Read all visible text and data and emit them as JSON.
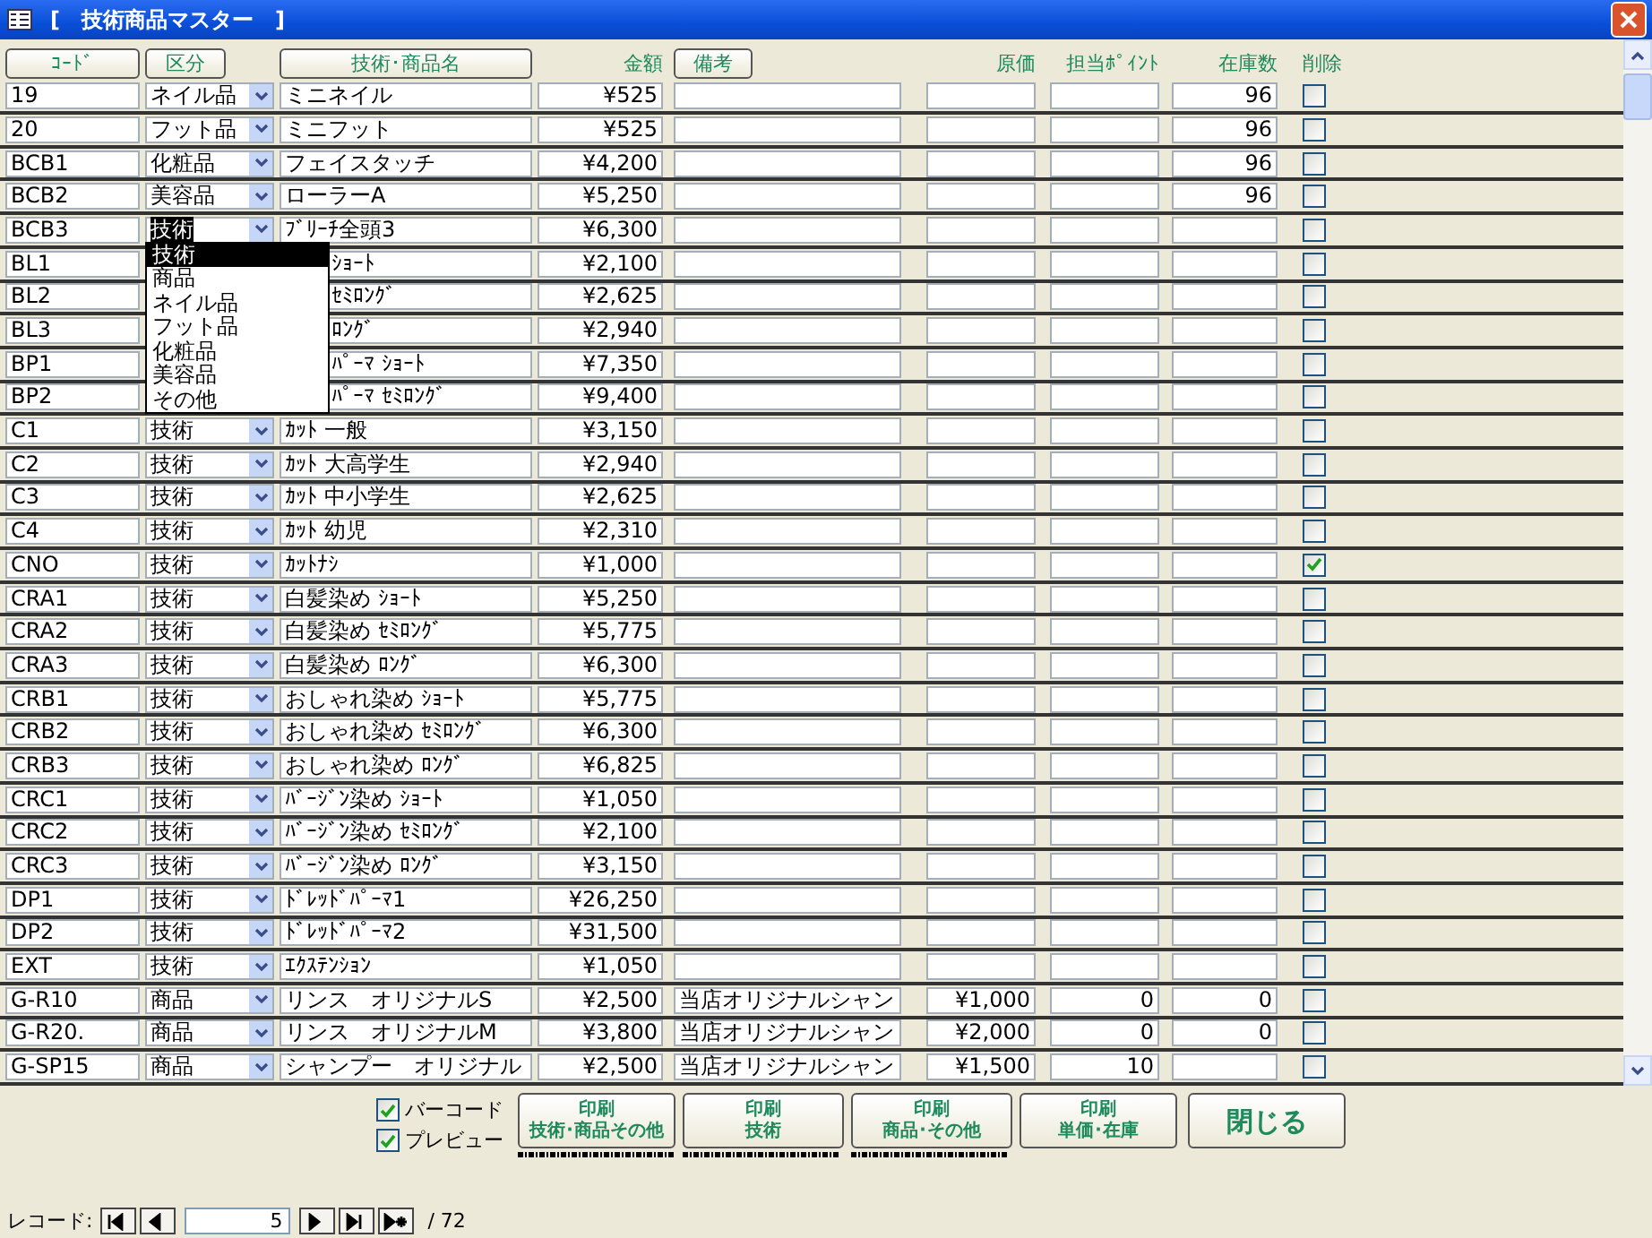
{
  "window": {
    "title": "[　技術商品マスター　]"
  },
  "header": [
    {
      "label": "ｺｰﾄﾞ",
      "kind": "button"
    },
    {
      "label": "区分",
      "kind": "button"
    },
    {
      "label": "技術･商品名",
      "kind": "button"
    },
    {
      "label": "金額",
      "kind": "label"
    },
    {
      "label": "備考",
      "kind": "button"
    },
    {
      "label": "原価",
      "kind": "label"
    },
    {
      "label": "担当ﾎﾟｲﾝﾄ",
      "kind": "label"
    },
    {
      "label": "在庫数",
      "kind": "label"
    },
    {
      "label": "削除",
      "kind": "label"
    }
  ],
  "rows": [
    {
      "code": "19",
      "category": "ネイル品",
      "name": "ミニネイル",
      "price": "¥525",
      "stock": "96",
      "deleted": false,
      "selected": false,
      "covered": false
    },
    {
      "code": "20",
      "category": "フット品",
      "name": "ミニフット",
      "price": "¥525",
      "stock": "96",
      "deleted": false,
      "selected": false,
      "covered": false
    },
    {
      "code": "BCB1",
      "category": "化粧品",
      "name": "フェイスタッチ",
      "price": "¥4,200",
      "stock": "96",
      "deleted": false,
      "selected": false,
      "covered": false
    },
    {
      "code": "BCB2",
      "category": "美容品",
      "name": "ローラーA",
      "price": "¥5,250",
      "stock": "96",
      "deleted": false,
      "selected": false,
      "covered": false
    },
    {
      "code": "BCB3",
      "category": "技術",
      "name": "ﾌﾞﾘｰﾁ全頭3",
      "price": "¥6,300",
      "deleted": false,
      "selected": true,
      "covered": false
    },
    {
      "code": "BL1",
      "name": "ｼｮｰﾄ",
      "price": "¥2,100",
      "deleted": false,
      "covered": true
    },
    {
      "code": "BL2",
      "name": "ｾﾐﾛﾝｸﾞ",
      "price": "¥2,625",
      "deleted": false,
      "covered": true
    },
    {
      "code": "BL3",
      "name": "ﾛﾝｸﾞ",
      "price": "¥2,940",
      "deleted": false,
      "covered": true
    },
    {
      "code": "BP1",
      "name": "ﾊﾟｰﾏ ｼｮｰﾄ",
      "price": "¥7,350",
      "deleted": false,
      "covered": true
    },
    {
      "code": "BP2",
      "name": "ﾊﾟｰﾏ ｾﾐﾛﾝｸﾞ",
      "price": "¥9,400",
      "deleted": false,
      "covered": true
    },
    {
      "code": "C1",
      "category": "技術",
      "name": "ｶｯﾄ 一般",
      "price": "¥3,150",
      "deleted": false,
      "selected": false,
      "covered": false
    },
    {
      "code": "C2",
      "category": "技術",
      "name": "ｶｯﾄ 大高学生",
      "price": "¥2,940",
      "deleted": false,
      "selected": false,
      "covered": false
    },
    {
      "code": "C3",
      "category": "技術",
      "name": "ｶｯﾄ 中小学生",
      "price": "¥2,625",
      "deleted": false,
      "selected": false,
      "covered": false
    },
    {
      "code": "C4",
      "category": "技術",
      "name": "ｶｯﾄ 幼児",
      "price": "¥2,310",
      "deleted": false,
      "selected": false,
      "covered": false
    },
    {
      "code": "CNO",
      "category": "技術",
      "name": "ｶｯﾄﾅｼ",
      "price": "¥1,000",
      "deleted": true,
      "selected": false,
      "covered": false
    },
    {
      "code": "CRA1",
      "category": "技術",
      "name": "白髪染め ｼｮｰﾄ",
      "price": "¥5,250",
      "deleted": false,
      "selected": false,
      "covered": false
    },
    {
      "code": "CRA2",
      "category": "技術",
      "name": "白髪染め ｾﾐﾛﾝｸﾞ",
      "price": "¥5,775",
      "deleted": false,
      "selected": false,
      "covered": false
    },
    {
      "code": "CRA3",
      "category": "技術",
      "name": "白髪染め ﾛﾝｸﾞ",
      "price": "¥6,300",
      "deleted": false,
      "selected": false,
      "covered": false
    },
    {
      "code": "CRB1",
      "category": "技術",
      "name": "おしゃれ染め ｼｮｰﾄ",
      "price": "¥5,775",
      "deleted": false,
      "selected": false,
      "covered": false
    },
    {
      "code": "CRB2",
      "category": "技術",
      "name": "おしゃれ染め ｾﾐﾛﾝｸﾞ",
      "price": "¥6,300",
      "deleted": false,
      "selected": false,
      "covered": false
    },
    {
      "code": "CRB3",
      "category": "技術",
      "name": "おしゃれ染め ﾛﾝｸﾞ",
      "price": "¥6,825",
      "deleted": false,
      "selected": false,
      "covered": false
    },
    {
      "code": "CRC1",
      "category": "技術",
      "name": "ﾊﾞｰｼﾞﾝ染め ｼｮｰﾄ",
      "price": "¥1,050",
      "deleted": false,
      "selected": false,
      "covered": false
    },
    {
      "code": "CRC2",
      "category": "技術",
      "name": "ﾊﾞｰｼﾞﾝ染め ｾﾐﾛﾝｸﾞ",
      "price": "¥2,100",
      "deleted": false,
      "selected": false,
      "covered": false
    },
    {
      "code": "CRC3",
      "category": "技術",
      "name": "ﾊﾞｰｼﾞﾝ染め ﾛﾝｸﾞ",
      "price": "¥3,150",
      "deleted": false,
      "selected": false,
      "covered": false
    },
    {
      "code": "DP1",
      "category": "技術",
      "name": "ﾄﾞﾚｯﾄﾞﾊﾟｰﾏ1",
      "price": "¥26,250",
      "deleted": false,
      "selected": false,
      "covered": false
    },
    {
      "code": "DP2",
      "category": "技術",
      "name": "ﾄﾞﾚｯﾄﾞﾊﾟｰﾏ2",
      "price": "¥31,500",
      "deleted": false,
      "selected": false,
      "covered": false
    },
    {
      "code": "EXT",
      "category": "技術",
      "name": "ｴｸｽﾃﾝｼｮﾝ",
      "price": "¥1,050",
      "deleted": false,
      "selected": false,
      "covered": false
    },
    {
      "code": "G-R10",
      "category": "商品",
      "name": "リンス　オリジナルS",
      "price": "¥2,500",
      "note": "当店オリジナルシャン",
      "cost": "¥1,000",
      "point": "0",
      "stock": "0",
      "deleted": false,
      "selected": false,
      "covered": false
    },
    {
      "code": "G-R20.",
      "category": "商品",
      "name": "リンス　オリジナルM",
      "price": "¥3,800",
      "note": "当店オリジナルシャン",
      "cost": "¥2,000",
      "point": "0",
      "stock": "0",
      "deleted": false,
      "selected": false,
      "covered": false
    },
    {
      "code": "G-SP15",
      "category": "商品",
      "name": "シャンプー　オリジナル",
      "price": "¥2,500",
      "note": "当店オリジナルシャン",
      "cost": "¥1,500",
      "point": "10",
      "deleted": false,
      "selected": false,
      "covered": false
    }
  ],
  "dropdown": {
    "options": [
      {
        "label": "技術",
        "selected": true
      },
      {
        "label": "商品",
        "selected": false
      },
      {
        "label": "ネイル品",
        "selected": false
      },
      {
        "label": "フット品",
        "selected": false
      },
      {
        "label": "化粧品",
        "selected": false
      },
      {
        "label": "美容品",
        "selected": false
      },
      {
        "label": "その他",
        "selected": false
      }
    ]
  },
  "options": [
    {
      "label": "バーコード",
      "checked": true
    },
    {
      "label": "プレビュー",
      "checked": true
    }
  ],
  "buttons": [
    {
      "lines": [
        "印刷",
        "技術･商品その他"
      ],
      "kind": "print",
      "barcode": true
    },
    {
      "lines": [
        "印刷",
        "技術"
      ],
      "kind": "print",
      "barcode": true
    },
    {
      "lines": [
        "印刷",
        "商品･その他"
      ],
      "kind": "print",
      "barcode": true
    },
    {
      "lines": [
        "印刷",
        "単価･在庫"
      ],
      "kind": "print",
      "barcode": false
    },
    {
      "lines": [
        "閉じる"
      ],
      "kind": "close",
      "barcode": false
    }
  ],
  "navigator": {
    "label": "レコード:",
    "current": "5",
    "total": "/ 72"
  }
}
